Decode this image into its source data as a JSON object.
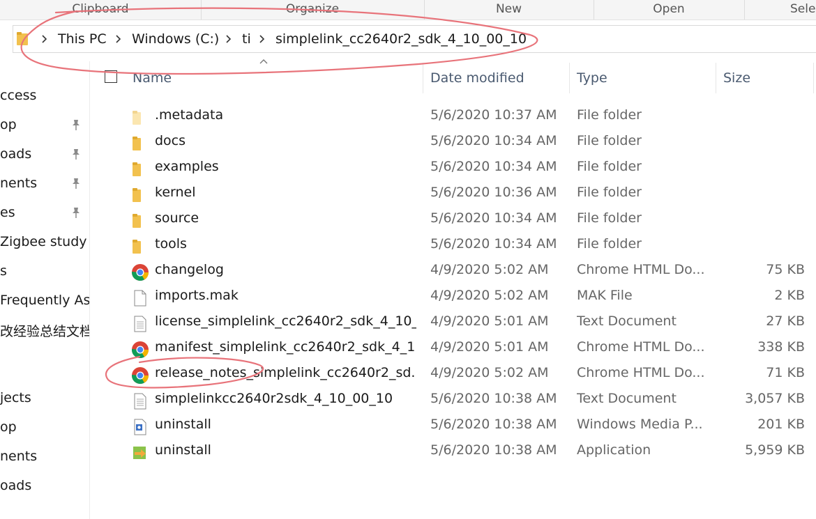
{
  "ribbon": {
    "groups": [
      "Clipboard",
      "Organize",
      "New",
      "Open",
      "Selec"
    ]
  },
  "address": {
    "crumbs": [
      "This PC",
      "Windows (C:)",
      "ti",
      "simplelink_cc2640r2_sdk_4_10_00_10"
    ]
  },
  "nav": {
    "items": [
      "ccess",
      "op",
      "oads",
      "nents",
      "es",
      "Zigbee study",
      "s",
      "Frequently As",
      "改经验总结文档",
      "jects",
      "op",
      "nents",
      "oads"
    ]
  },
  "columns": {
    "name": "Name",
    "date": "Date modified",
    "type": "Type",
    "size": "Size"
  },
  "files": [
    {
      "name": ".metadata",
      "date": "5/6/2020 10:37 AM",
      "type": "File folder",
      "size": "",
      "icon": "folder-light-icon"
    },
    {
      "name": "docs",
      "date": "5/6/2020 10:34 AM",
      "type": "File folder",
      "size": "",
      "icon": "folder-icon"
    },
    {
      "name": "examples",
      "date": "5/6/2020 10:34 AM",
      "type": "File folder",
      "size": "",
      "icon": "folder-icon"
    },
    {
      "name": "kernel",
      "date": "5/6/2020 10:36 AM",
      "type": "File folder",
      "size": "",
      "icon": "folder-icon"
    },
    {
      "name": "source",
      "date": "5/6/2020 10:34 AM",
      "type": "File folder",
      "size": "",
      "icon": "folder-icon"
    },
    {
      "name": "tools",
      "date": "5/6/2020 10:34 AM",
      "type": "File folder",
      "size": "",
      "icon": "folder-icon"
    },
    {
      "name": "changelog",
      "date": "4/9/2020 5:02 AM",
      "type": "Chrome HTML Do...",
      "size": "75 KB",
      "icon": "chrome-icon"
    },
    {
      "name": "imports.mak",
      "date": "4/9/2020 5:02 AM",
      "type": "MAK File",
      "size": "2 KB",
      "icon": "blank-file-icon"
    },
    {
      "name": "license_simplelink_cc2640r2_sdk_4_10_...",
      "date": "4/9/2020 5:01 AM",
      "type": "Text Document",
      "size": "27 KB",
      "icon": "text-file-icon"
    },
    {
      "name": "manifest_simplelink_cc2640r2_sdk_4_1...",
      "date": "4/9/2020 5:01 AM",
      "type": "Chrome HTML Do...",
      "size": "338 KB",
      "icon": "chrome-icon"
    },
    {
      "name": "release_notes_simplelink_cc2640r2_sd...",
      "date": "4/9/2020 5:02 AM",
      "type": "Chrome HTML Do...",
      "size": "71 KB",
      "icon": "chrome-icon"
    },
    {
      "name": "simplelinkcc2640r2sdk_4_10_00_10",
      "date": "5/6/2020 10:38 AM",
      "type": "Text Document",
      "size": "3,057 KB",
      "icon": "text-file-icon"
    },
    {
      "name": "uninstall",
      "date": "5/6/2020 10:38 AM",
      "type": "Windows Media P...",
      "size": "201 KB",
      "icon": "media-playlist-icon"
    },
    {
      "name": "uninstall",
      "date": "5/6/2020 10:38 AM",
      "type": "Application",
      "size": "5,959 KB",
      "icon": "installer-app-icon"
    }
  ],
  "colors": {
    "annotation": "#e8737a",
    "folder": "#f2c14e",
    "header_text": "#4a5a70"
  }
}
